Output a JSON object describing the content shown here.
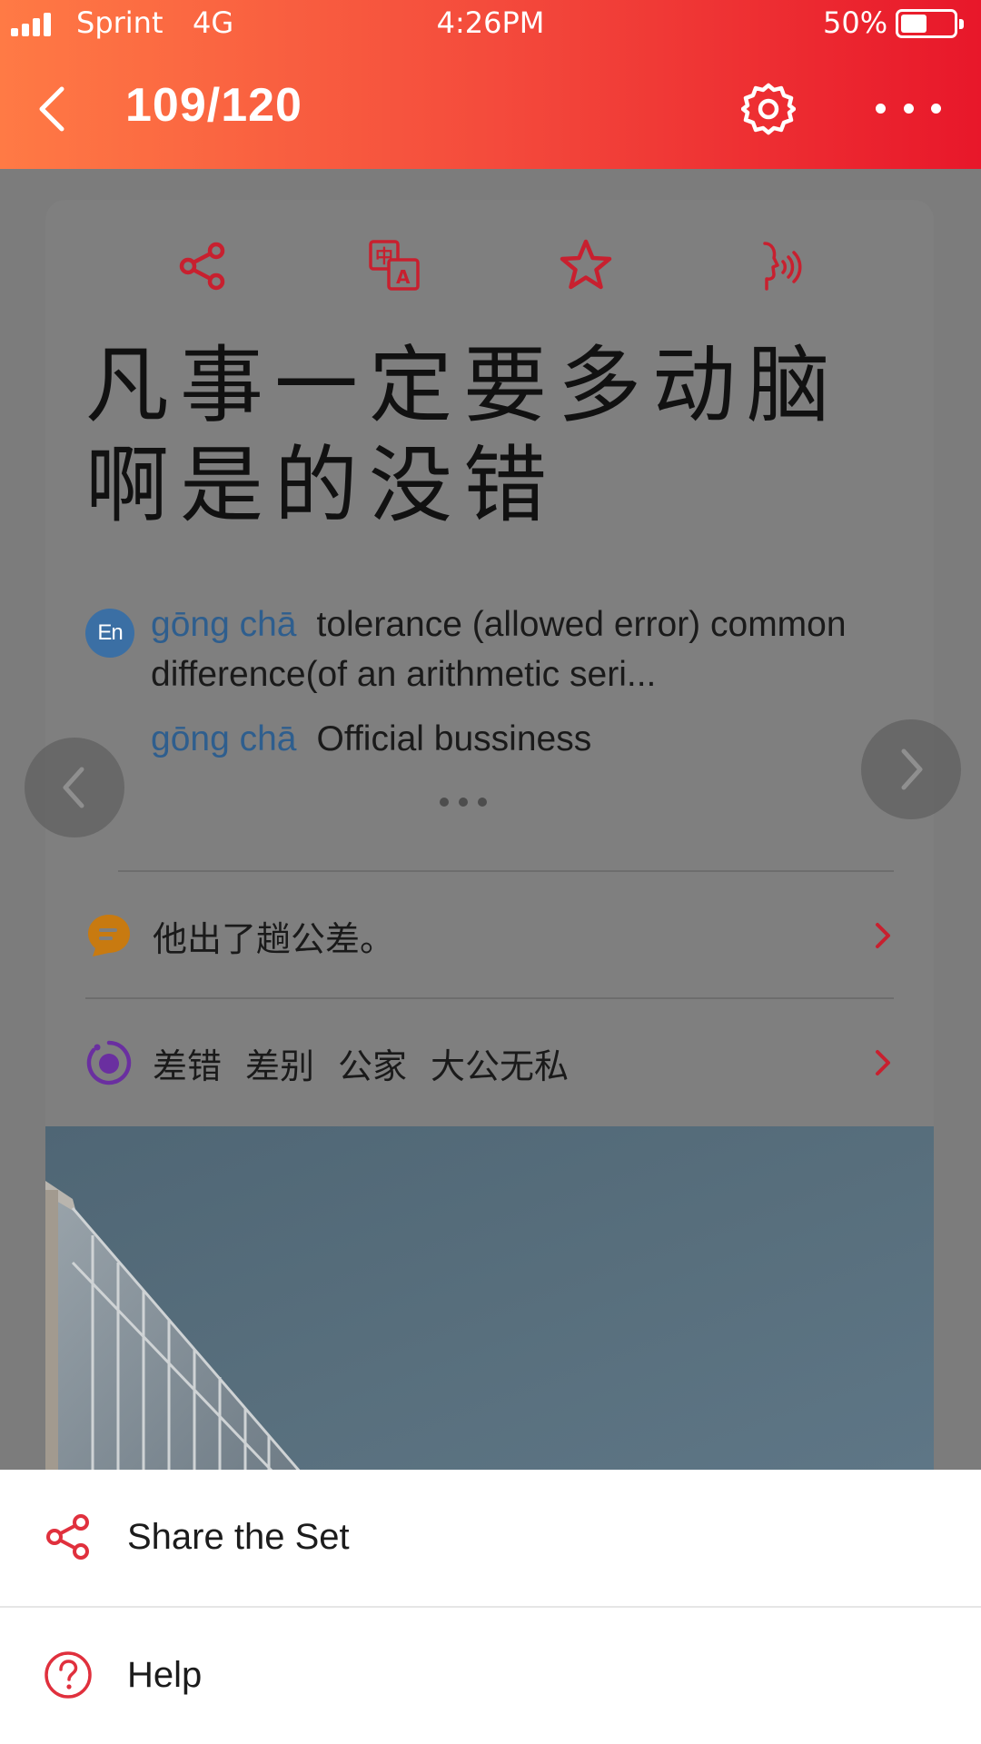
{
  "status_bar": {
    "carrier": "Sprint",
    "network": "4G",
    "time": "4:26PM",
    "battery_percent": "50%",
    "battery_level": 0.5
  },
  "nav": {
    "back_icon": "chevron-left-icon",
    "page_counter": "109/120",
    "settings_icon": "gear-icon",
    "more_icon": "more-horizontal-icon"
  },
  "card": {
    "actions": [
      {
        "icon": "share-icon"
      },
      {
        "icon": "translate-icon"
      },
      {
        "icon": "star-icon"
      },
      {
        "icon": "speak-icon"
      }
    ],
    "headword": "凡事一定要多动脑啊是的没错",
    "definitions": [
      {
        "pinyin": "gōng chā",
        "gloss": "tolerance (allowed error) common difference(of an arithmetic seri..."
      },
      {
        "pinyin": "gōng chā",
        "gloss": "Official bussiness"
      }
    ],
    "en_badge": "En",
    "example_sentence": "他出了趟公差。",
    "related_words": [
      "差错",
      "差别",
      "公家",
      "大公无私"
    ]
  },
  "bottom_sheet": {
    "items": [
      {
        "label": "Share the Set",
        "icon": "share-icon"
      },
      {
        "label": "Help",
        "icon": "help-circle-icon"
      }
    ]
  },
  "colors": {
    "accent_red": "#e8172a",
    "header_gradient_start": "#ff7a45",
    "pinyin_blue": "#2e5e8e",
    "example_orange": "#c87a10",
    "related_purple": "#6a2fa0"
  }
}
